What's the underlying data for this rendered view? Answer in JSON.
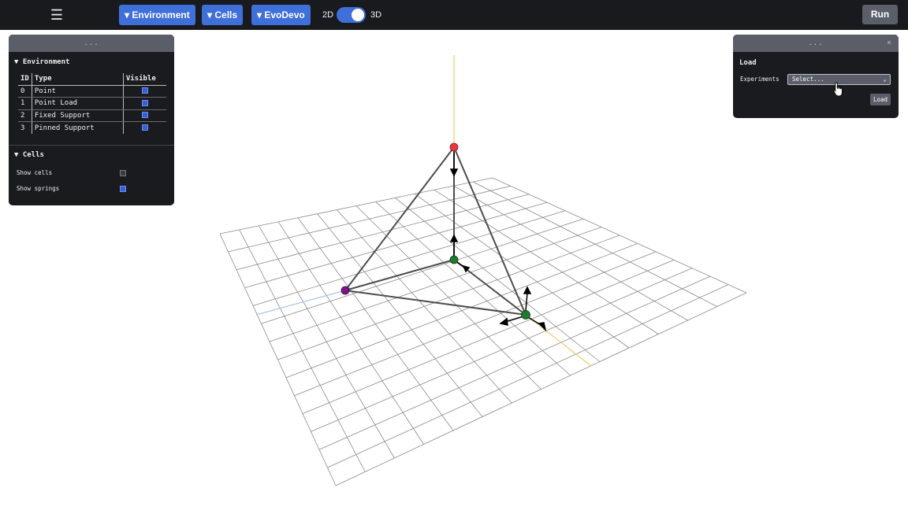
{
  "topbar": {
    "menu_icon": "hamburger-menu-icon",
    "menus": [
      {
        "label": "▾ Environment"
      },
      {
        "label": "▾ Cells"
      },
      {
        "label": "▾ EvoDevo"
      }
    ],
    "toggle": {
      "left_label": "2D",
      "right_label": "3D",
      "state": "3D"
    },
    "run_label": "Run"
  },
  "left_panel": {
    "handle": "...",
    "environment_title": "▼ Environment",
    "table": {
      "headers": [
        "ID",
        "Type",
        "Visible"
      ],
      "rows": [
        {
          "id": "0",
          "type": "Point",
          "visible": true
        },
        {
          "id": "1",
          "type": "Point Load",
          "visible": true
        },
        {
          "id": "2",
          "type": "Fixed Support",
          "visible": true
        },
        {
          "id": "3",
          "type": "Pinned Support",
          "visible": true
        }
      ]
    },
    "cells_title": "▼ Cells",
    "options": [
      {
        "label": "Show cells",
        "checked": false
      },
      {
        "label": "Show springs",
        "checked": true
      }
    ]
  },
  "right_panel": {
    "handle": "...",
    "close": "×",
    "title": "Load",
    "experiments_label": "Experiments",
    "select_value": "Select...",
    "load_label": "Load"
  },
  "colors": {
    "topbar_bg": "#191a1e",
    "accent": "#3f6fd9",
    "panel_bg": "#1a1b1f",
    "node_top": "#e8383d",
    "node_support": "#1f7a2e",
    "node_pinned": "#7b1686",
    "beam": "#4d4d4d",
    "axis_y": "#e8cf7c",
    "axis_x": "#a9c7e8"
  }
}
